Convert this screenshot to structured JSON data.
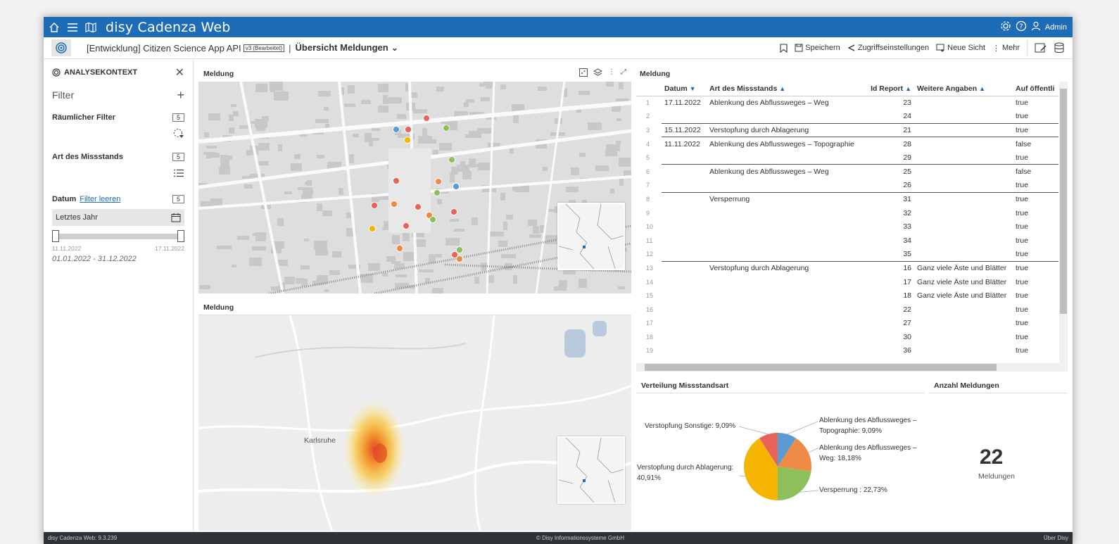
{
  "app": {
    "name": "disy Cadenza Web",
    "user": "Admin"
  },
  "toolbar": {
    "project": "[Entwicklung] Citizen Science App API",
    "version": "v3 (Bearbeitet)",
    "view": "Übersicht Meldungen",
    "actions": {
      "save": "Speichern",
      "access": "Zugriffseinstellungen",
      "new_view": "Neue Sicht",
      "more": "Mehr"
    }
  },
  "sidebar": {
    "title": "ANALYSEKONTEXT",
    "filter_label": "Filter",
    "spatial": {
      "label": "Räumlicher Filter",
      "count": "5"
    },
    "type": {
      "label": "Art des Missstands",
      "count": "5"
    },
    "date": {
      "label": "Datum",
      "clear": "Filter leeren",
      "count": "5",
      "value": "Letztes Jahr",
      "min": "11.11.2022",
      "max": "17.11.2022",
      "range": "01.01.2022 - 31.12.2022"
    }
  },
  "map1": {
    "title": "Meldung"
  },
  "map2": {
    "title": "Meldung",
    "city": "Karlsruhe"
  },
  "table": {
    "title": "Meldung",
    "columns": [
      "Datum",
      "Art des Missstands",
      "Id Report",
      "Weitere Angaben",
      "Auf öffentli"
    ],
    "rows": [
      {
        "n": "1",
        "date": "17.11.2022",
        "type": "Ablenkung des Abflussweges – Weg",
        "id": "23",
        "more": "",
        "pub": "true",
        "bt": true
      },
      {
        "n": "2",
        "date": "",
        "type": "",
        "id": "24",
        "more": "",
        "pub": "true",
        "bt": false
      },
      {
        "n": "3",
        "date": "15.11.2022",
        "type": "Verstopfung durch Ablagerung",
        "id": "21",
        "more": "",
        "pub": "true",
        "bt": true
      },
      {
        "n": "4",
        "date": "11.11.2022",
        "type": "Ablenkung des Abflussweges – Topographie",
        "id": "28",
        "more": "",
        "pub": "false",
        "bt": true
      },
      {
        "n": "5",
        "date": "",
        "type": "",
        "id": "29",
        "more": "",
        "pub": "true",
        "bt": false
      },
      {
        "n": "6",
        "date": "",
        "type": "Ablenkung des Abflussweges – Weg",
        "id": "25",
        "more": "",
        "pub": "false",
        "bt": true
      },
      {
        "n": "7",
        "date": "",
        "type": "",
        "id": "26",
        "more": "",
        "pub": "true",
        "bt": false
      },
      {
        "n": "8",
        "date": "",
        "type": "Versperrung",
        "id": "31",
        "more": "",
        "pub": "true",
        "bt": true
      },
      {
        "n": "9",
        "date": "",
        "type": "",
        "id": "32",
        "more": "",
        "pub": "true",
        "bt": false
      },
      {
        "n": "10",
        "date": "",
        "type": "",
        "id": "33",
        "more": "",
        "pub": "true",
        "bt": false
      },
      {
        "n": "11",
        "date": "",
        "type": "",
        "id": "34",
        "more": "",
        "pub": "true",
        "bt": false
      },
      {
        "n": "12",
        "date": "",
        "type": "",
        "id": "35",
        "more": "",
        "pub": "true",
        "bt": false
      },
      {
        "n": "13",
        "date": "",
        "type": "Verstopfung durch Ablagerung",
        "id": "16",
        "more": "Ganz viele Äste und Blätter",
        "pub": "true",
        "bt": true
      },
      {
        "n": "14",
        "date": "",
        "type": "",
        "id": "17",
        "more": "Ganz viele Äste und Blätter",
        "pub": "true",
        "bt": false
      },
      {
        "n": "15",
        "date": "",
        "type": "",
        "id": "18",
        "more": "Ganz viele Äste und Blätter",
        "pub": "true",
        "bt": false
      },
      {
        "n": "16",
        "date": "",
        "type": "",
        "id": "22",
        "more": "",
        "pub": "true",
        "bt": false
      },
      {
        "n": "17",
        "date": "",
        "type": "",
        "id": "27",
        "more": "",
        "pub": "true",
        "bt": false
      },
      {
        "n": "18",
        "date": "",
        "type": "",
        "id": "30",
        "more": "",
        "pub": "true",
        "bt": false
      },
      {
        "n": "19",
        "date": "",
        "type": "",
        "id": "36",
        "more": "",
        "pub": "true",
        "bt": false
      }
    ]
  },
  "pie": {
    "title": "Verteilung Missstandsart",
    "label_sonstige": "Verstopfung Sonstige: 9,09%",
    "label_ablagerung_1": "Verstopfung durch Ablagerung:",
    "label_ablagerung_2": "40,91%",
    "label_topo_1": "Ablenkung des Abflussweges –",
    "label_topo_2": "Topographie: 9,09%",
    "label_weg_1": "Ablenkung des Abflussweges –",
    "label_weg_2": "Weg: 18,18%",
    "label_versperrung": "Versperrung : 22,73%"
  },
  "chart_data": {
    "type": "pie",
    "title": "Verteilung Missstandsart",
    "categories": [
      "Ablenkung des Abflussweges – Topographie",
      "Ablenkung des Abflussweges – Weg",
      "Versperrung",
      "Verstopfung durch Ablagerung",
      "Verstopfung Sonstige"
    ],
    "values": [
      9.09,
      18.18,
      22.73,
      40.91,
      9.09
    ],
    "colors": [
      "#5b9bd5",
      "#ed8a45",
      "#8dc05a",
      "#f5b400",
      "#e8645a"
    ]
  },
  "kpi": {
    "title": "Anzahl Meldungen",
    "value": "22",
    "label": "Meldungen"
  },
  "map_points": [
    {
      "c": "#5b9bd5"
    },
    {
      "c": "#e8645a"
    },
    {
      "c": "#e8645a"
    },
    {
      "c": "#8dc05a"
    },
    {
      "c": "#f5b400"
    },
    {
      "c": "#8dc05a"
    },
    {
      "c": "#e8645a"
    },
    {
      "c": "#ed8a45"
    },
    {
      "c": "#5b9bd5"
    },
    {
      "c": "#8dc05a"
    },
    {
      "c": "#e8645a"
    },
    {
      "c": "#ed8a45"
    },
    {
      "c": "#e8645a"
    },
    {
      "c": "#ed8a45"
    },
    {
      "c": "#e8645a"
    },
    {
      "c": "#8dc05a"
    },
    {
      "c": "#f5b400"
    },
    {
      "c": "#e8645a"
    },
    {
      "c": "#ed8a45"
    },
    {
      "c": "#8dc05a"
    },
    {
      "c": "#e8645a"
    },
    {
      "c": "#ed8a45"
    }
  ],
  "footer": {
    "version": "disy Cadenza Web: 9.3.239",
    "copyright": "© Disy Informationssysteme GmbH",
    "about": "Über Disy"
  }
}
